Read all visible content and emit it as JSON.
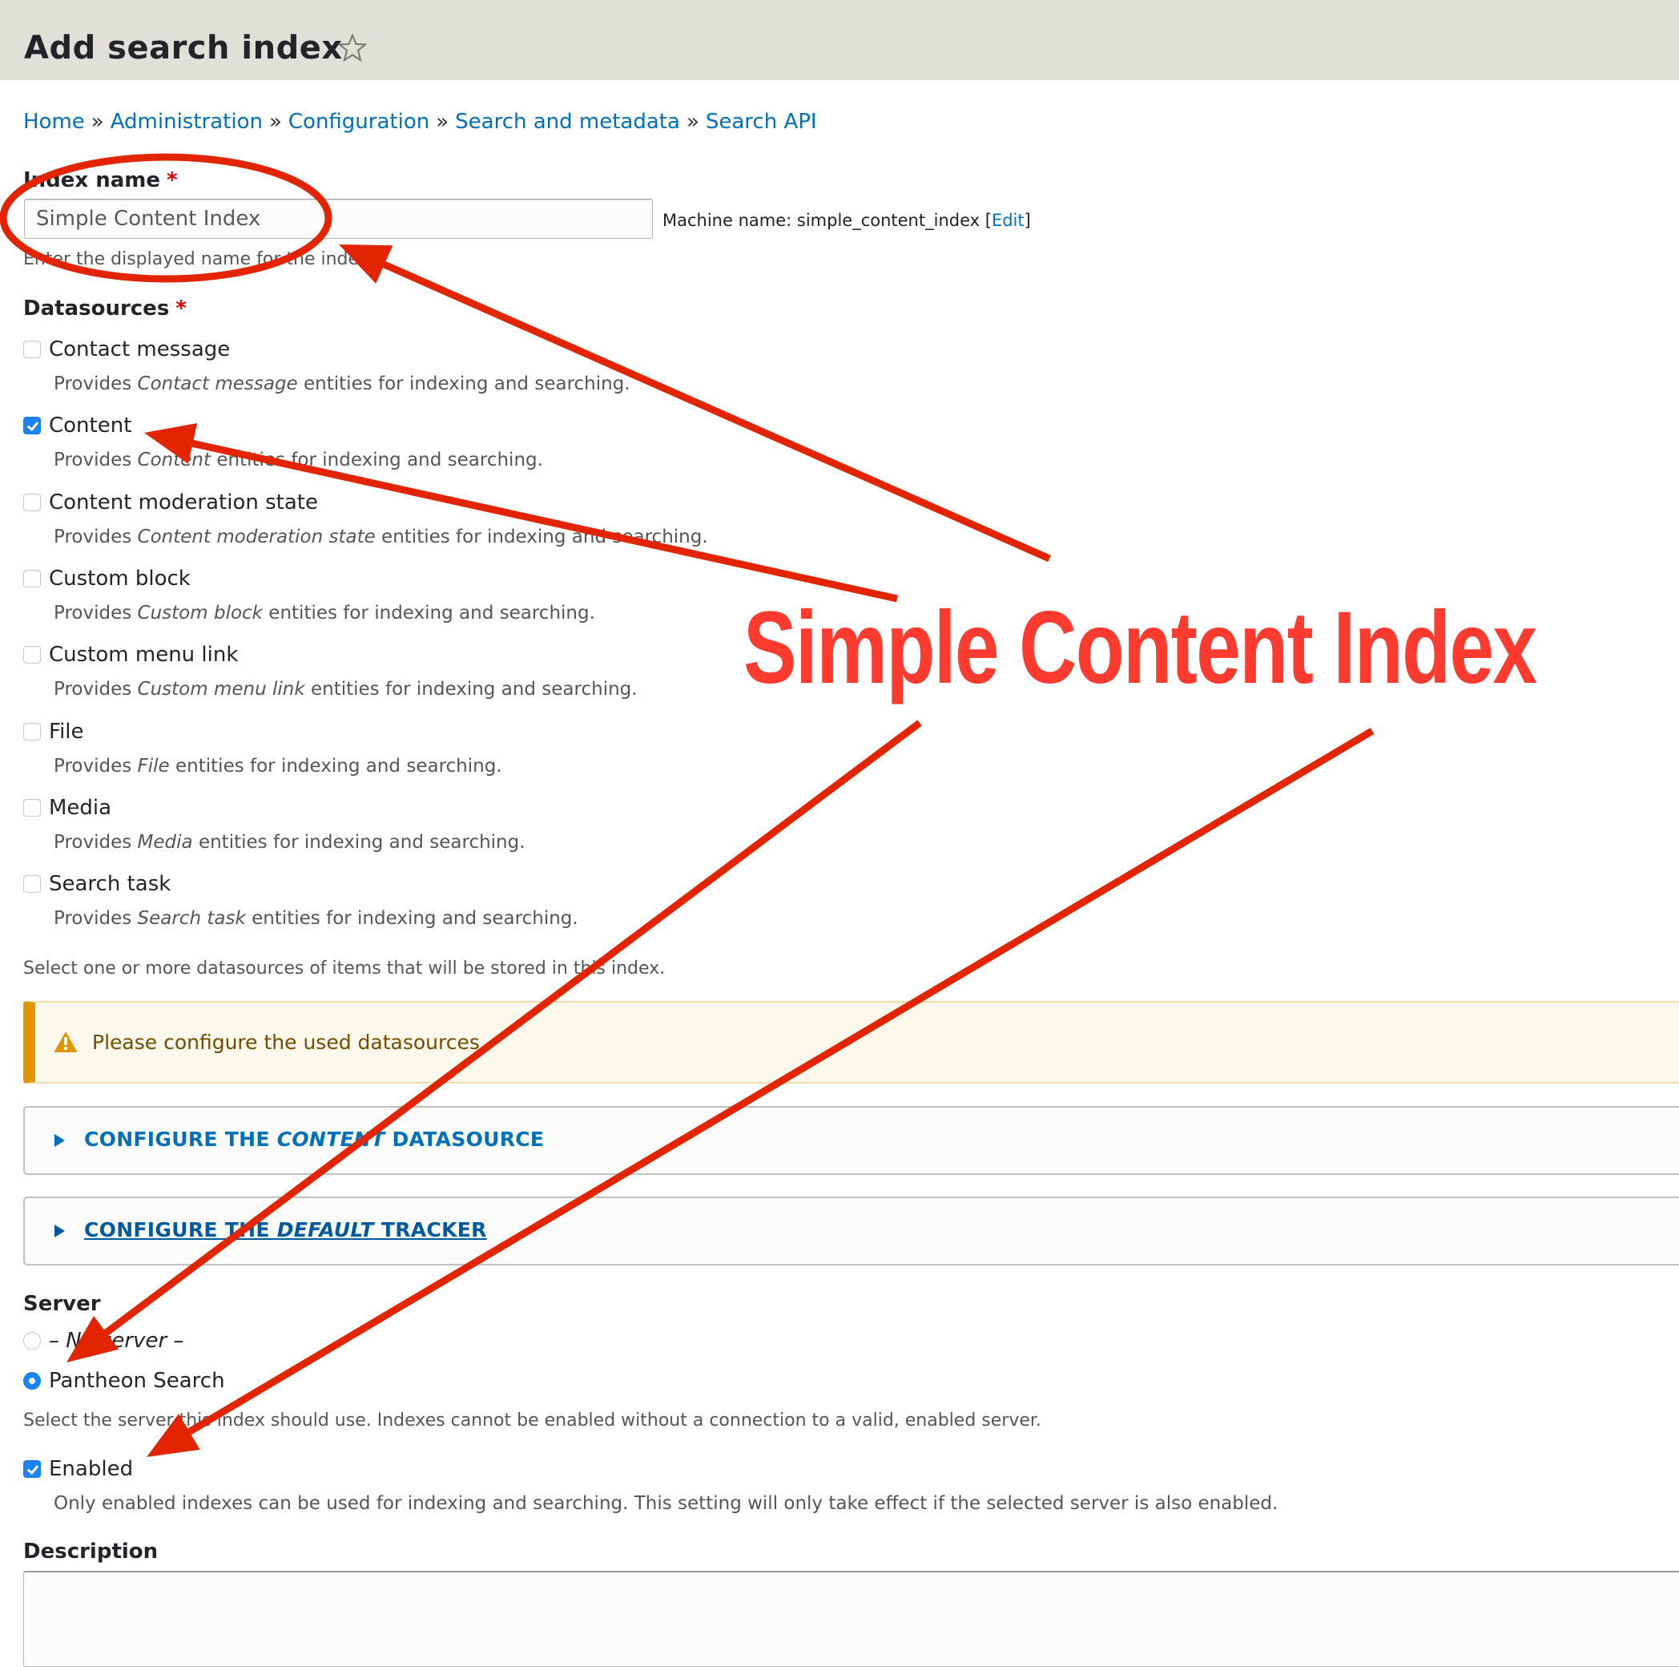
{
  "header": {
    "title": "Add search index",
    "favorite_icon": "star-outline-icon"
  },
  "breadcrumb": [
    {
      "label": "Home"
    },
    {
      "label": "Administration"
    },
    {
      "label": "Configuration"
    },
    {
      "label": "Search and metadata"
    },
    {
      "label": "Search API"
    }
  ],
  "breadcrumb_separator": "»",
  "index_name": {
    "label": "Index name",
    "required_marker": "*",
    "value": "Simple Content Index",
    "machine_name_prefix": "Machine name: simple_content_index [",
    "machine_name_edit": "Edit",
    "machine_name_suffix": "]",
    "help": "Enter the displayed name for the index."
  },
  "datasources": {
    "label": "Datasources",
    "required_marker": "*",
    "options": [
      {
        "label": "Contact message",
        "checked": false,
        "desc_prefix": "Provides ",
        "desc_em": "Contact message",
        "desc_suffix": " entities for indexing and searching."
      },
      {
        "label": "Content",
        "checked": true,
        "desc_prefix": "Provides ",
        "desc_em": "Content",
        "desc_suffix": " entities for indexing and searching."
      },
      {
        "label": "Content moderation state",
        "checked": false,
        "desc_prefix": "Provides ",
        "desc_em": "Content moderation state",
        "desc_suffix": " entities for indexing and searching."
      },
      {
        "label": "Custom block",
        "checked": false,
        "desc_prefix": "Provides ",
        "desc_em": "Custom block",
        "desc_suffix": " entities for indexing and searching."
      },
      {
        "label": "Custom menu link",
        "checked": false,
        "desc_prefix": "Provides ",
        "desc_em": "Custom menu link",
        "desc_suffix": " entities for indexing and searching."
      },
      {
        "label": "File",
        "checked": false,
        "desc_prefix": "Provides ",
        "desc_em": "File",
        "desc_suffix": " entities for indexing and searching."
      },
      {
        "label": "Media",
        "checked": false,
        "desc_prefix": "Provides ",
        "desc_em": "Media",
        "desc_suffix": " entities for indexing and searching."
      },
      {
        "label": "Search task",
        "checked": false,
        "desc_prefix": "Provides ",
        "desc_em": "Search task",
        "desc_suffix": " entities for indexing and searching."
      }
    ],
    "help": "Select one or more datasources of items that will be stored in this index."
  },
  "warning": {
    "icon": "warning-triangle-icon",
    "text": "Please configure the used datasources."
  },
  "details": [
    {
      "prefix": "CONFIGURE THE ",
      "em": "CONTENT",
      "suffix": " DATASOURCE",
      "expanded": false
    },
    {
      "prefix": "CONFIGURE THE ",
      "em": "DEFAULT",
      "suffix": " TRACKER",
      "expanded": false
    }
  ],
  "server": {
    "label": "Server",
    "options": [
      {
        "label": "– No server –",
        "selected": false
      },
      {
        "label": "Pantheon Search",
        "selected": true
      }
    ],
    "help": "Select the server this index should use. Indexes cannot be enabled without a connection to a valid, enabled server."
  },
  "enabled": {
    "label": "Enabled",
    "checked": true,
    "help": "Only enabled indexes can be used for indexing and searching. This setting will only take effect if the selected server is also enabled."
  },
  "description": {
    "label": "Description",
    "value": ""
  },
  "annotation": {
    "text": "Simple Content Index",
    "color": "#ff3b30",
    "arrow_color": "#e22400"
  },
  "colors": {
    "link": "#0071b8",
    "header_bg": "#e0e0d8",
    "required": "#e00000",
    "checkbox_checked": "#1a84f4",
    "warning_border": "#e09600",
    "warning_text": "#734c00"
  }
}
